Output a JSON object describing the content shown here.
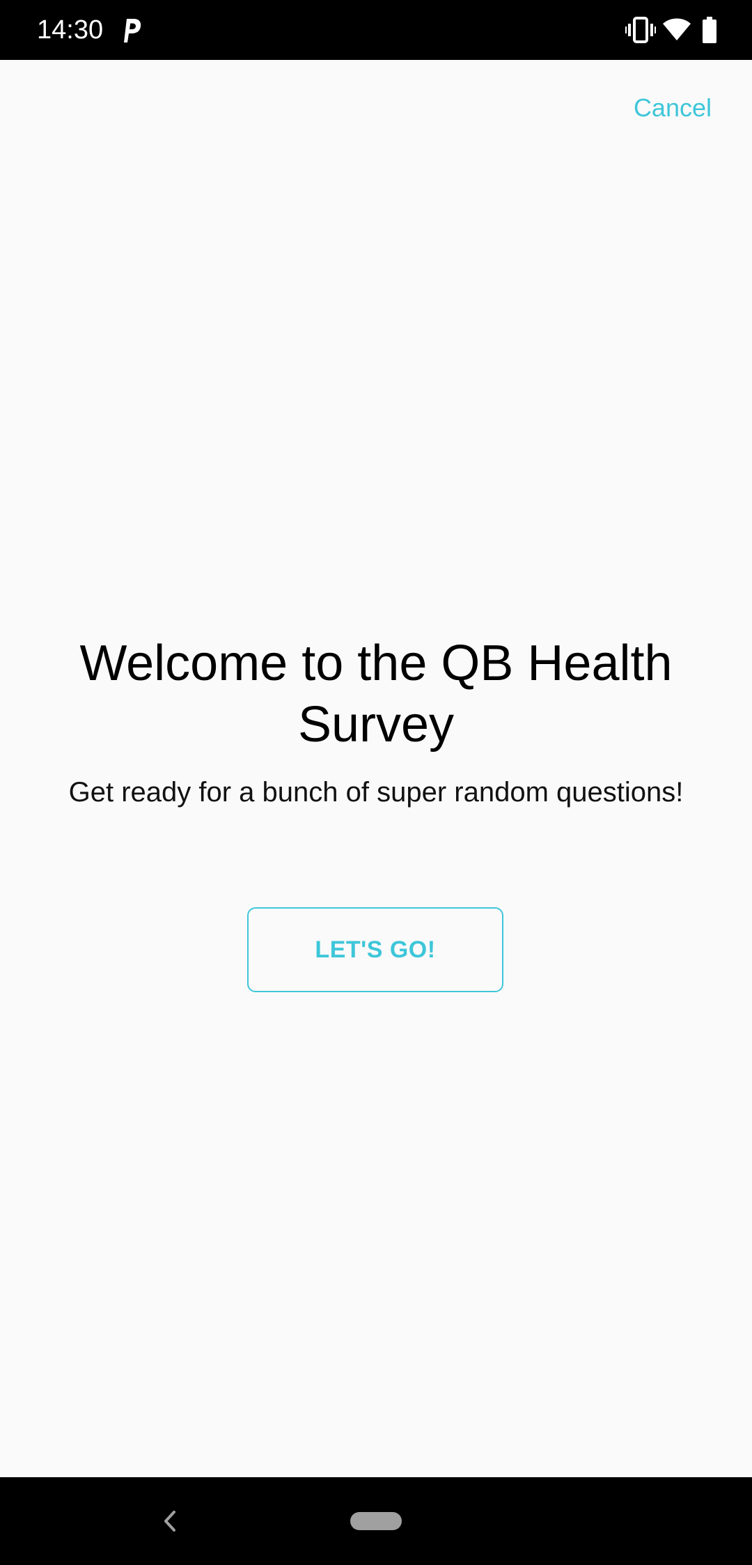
{
  "status_bar": {
    "time": "14:30",
    "app_icon": "parking-p-icon",
    "icons": [
      "vibrate-icon",
      "wifi-icon",
      "battery-icon"
    ]
  },
  "header": {
    "cancel_label": "Cancel"
  },
  "welcome": {
    "title": "Welcome to the QB Health Survey",
    "subtitle": "Get ready for a bunch of super random questions!",
    "start_label": "LET'S GO!"
  },
  "nav_bar": {
    "icons": [
      "back-icon",
      "home-pill-icon"
    ]
  },
  "colors": {
    "accent": "#3ec6d9",
    "background": "#fafafa",
    "system_bars": "#000000"
  }
}
